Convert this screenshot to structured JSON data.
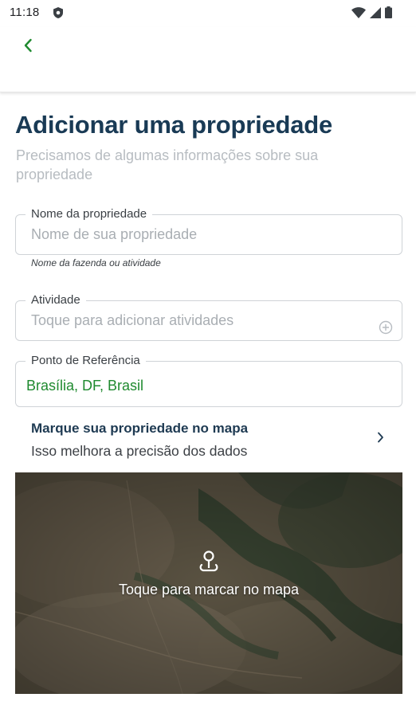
{
  "status_bar": {
    "time": "11:18"
  },
  "page": {
    "title": "Adicionar uma propriedade",
    "subtitle": "Precisamos de algumas informações sobre sua propriedade"
  },
  "form": {
    "name_field": {
      "label": "Nome da propriedade",
      "placeholder": "Nome de sua propriedade",
      "helper": "Nome da fazenda ou atividade"
    },
    "activity_field": {
      "label": "Atividade",
      "placeholder": "Toque para adicionar atividades"
    },
    "reference_field": {
      "label": "Ponto de Referência",
      "value": "Brasília, DF, Brasil"
    }
  },
  "map_section": {
    "title": "Marque sua propriedade no mapa",
    "subtitle": "Isso melhora a precisão dos dados",
    "cta": "Toque para marcar no mapa"
  },
  "icons": {
    "back": "chevron-left-icon",
    "add_activity": "add-circle-icon",
    "map_row": "chevron-right-icon",
    "map_pin": "location-pin-icon"
  },
  "colors": {
    "brand_green": "#1f8a2f",
    "title_navy": "#193a55",
    "placeholder_gray": "#a9aeb3"
  }
}
